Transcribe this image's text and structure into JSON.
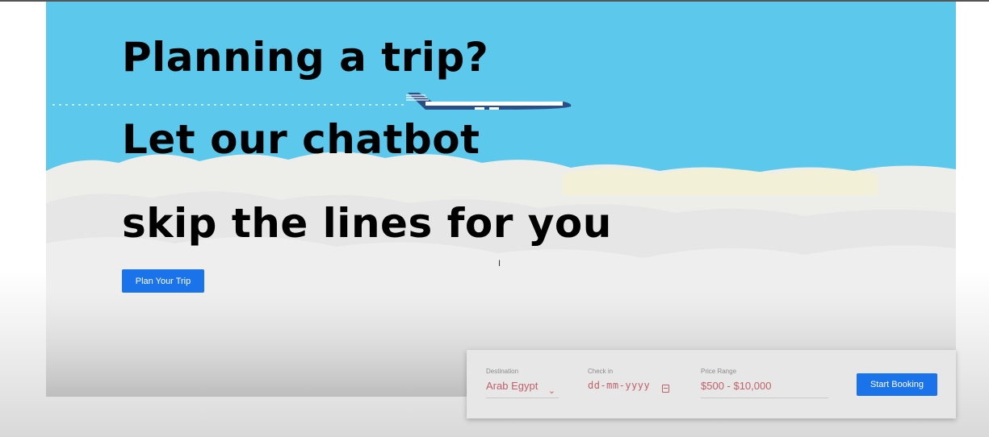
{
  "hero": {
    "line1": "Planning a trip?",
    "line2": "Let our chatbot",
    "line3": "skip the lines for you",
    "cta_label": "Plan Your Trip",
    "sky_color": "#5bc8ec",
    "decoration_icons": [
      "airplane-icon",
      "clouds"
    ]
  },
  "booking": {
    "destination": {
      "label": "Destination",
      "value": "Arab Egypt",
      "icon": "chevron-down-icon"
    },
    "checkin": {
      "label": "Check in",
      "placeholder": "dd-mm-yyyy",
      "icon": "calendar-icon"
    },
    "price": {
      "label": "Price Range",
      "value": "$500 - $10,000"
    },
    "submit_label": "Start Booking",
    "accent_color": "#1a73e8",
    "value_color": "#c0606a"
  },
  "cursor_glyph": "I"
}
